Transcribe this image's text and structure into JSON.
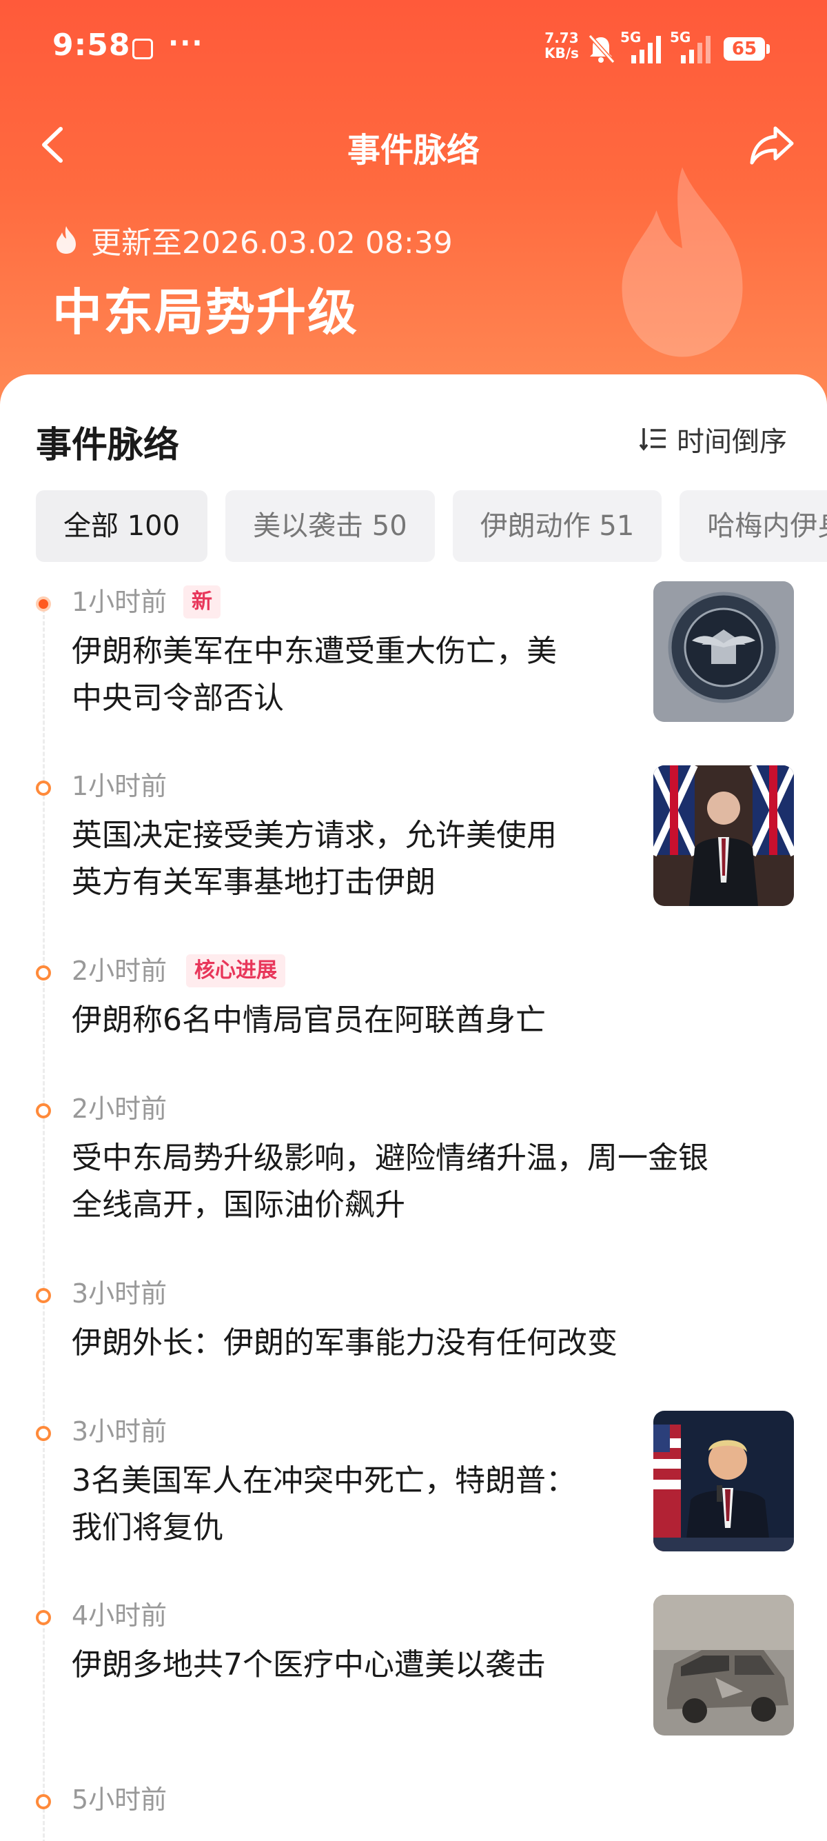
{
  "status_bar": {
    "time": "9:58",
    "dots": "···",
    "speed_value": "7.73",
    "speed_unit": "KB/s",
    "network_1": "5G",
    "network_2": "5G",
    "battery": "65"
  },
  "nav": {
    "title": "事件脉络"
  },
  "header": {
    "update_text": "更新至2026.03.02 08:39",
    "topic_title": "中东局势升级"
  },
  "section": {
    "title": "事件脉络",
    "sort_label": "时间倒序"
  },
  "filters": [
    {
      "label": "全部 100",
      "active": true
    },
    {
      "label": "美以袭击 50",
      "active": false
    },
    {
      "label": "伊朗动作 51",
      "active": false
    },
    {
      "label": "哈梅内伊身",
      "active": false
    }
  ],
  "events": [
    {
      "time": "1小时前",
      "badge": "新",
      "lines": [
        "伊朗称美军在中东遭受重大伤亡，美",
        "中央司令部否认"
      ],
      "thumbnail": "central-command-seal"
    },
    {
      "time": "1小时前",
      "badge": "",
      "lines": [
        "英国决定接受美方请求，允许美使用",
        "英方有关军事基地打击伊朗"
      ],
      "thumbnail": "speaker-uk-flags"
    },
    {
      "time": "2小时前",
      "badge": "核心进展",
      "lines": [
        "伊朗称6名中情局官员在阿联酋身亡"
      ],
      "thumbnail": ""
    },
    {
      "time": "2小时前",
      "badge": "",
      "lines": [
        "受中东局势升级影响，避险情绪升温，周一金银",
        "全线高开，国际油价飙升"
      ],
      "thumbnail": ""
    },
    {
      "time": "3小时前",
      "badge": "",
      "lines": [
        "伊朗外长：伊朗的军事能力没有任何改变"
      ],
      "thumbnail": ""
    },
    {
      "time": "3小时前",
      "badge": "",
      "lines": [
        "3名美国军人在冲突中死亡，特朗普：",
        "我们将复仇"
      ],
      "thumbnail": "speaker-us-flag"
    },
    {
      "time": "4小时前",
      "badge": "",
      "lines": [
        "伊朗多地共7个医疗中心遭美以袭击"
      ],
      "thumbnail": "damaged-vehicle"
    },
    {
      "time": "5小时前",
      "badge": "",
      "lines": [],
      "thumbnail": ""
    }
  ],
  "colors": {
    "header_top": "#ff5a3a",
    "header_bottom": "#ff8a55",
    "accent_dot": "#ff5a1f",
    "badge_text": "#e8365a",
    "badge_bg": "#ffecee"
  }
}
